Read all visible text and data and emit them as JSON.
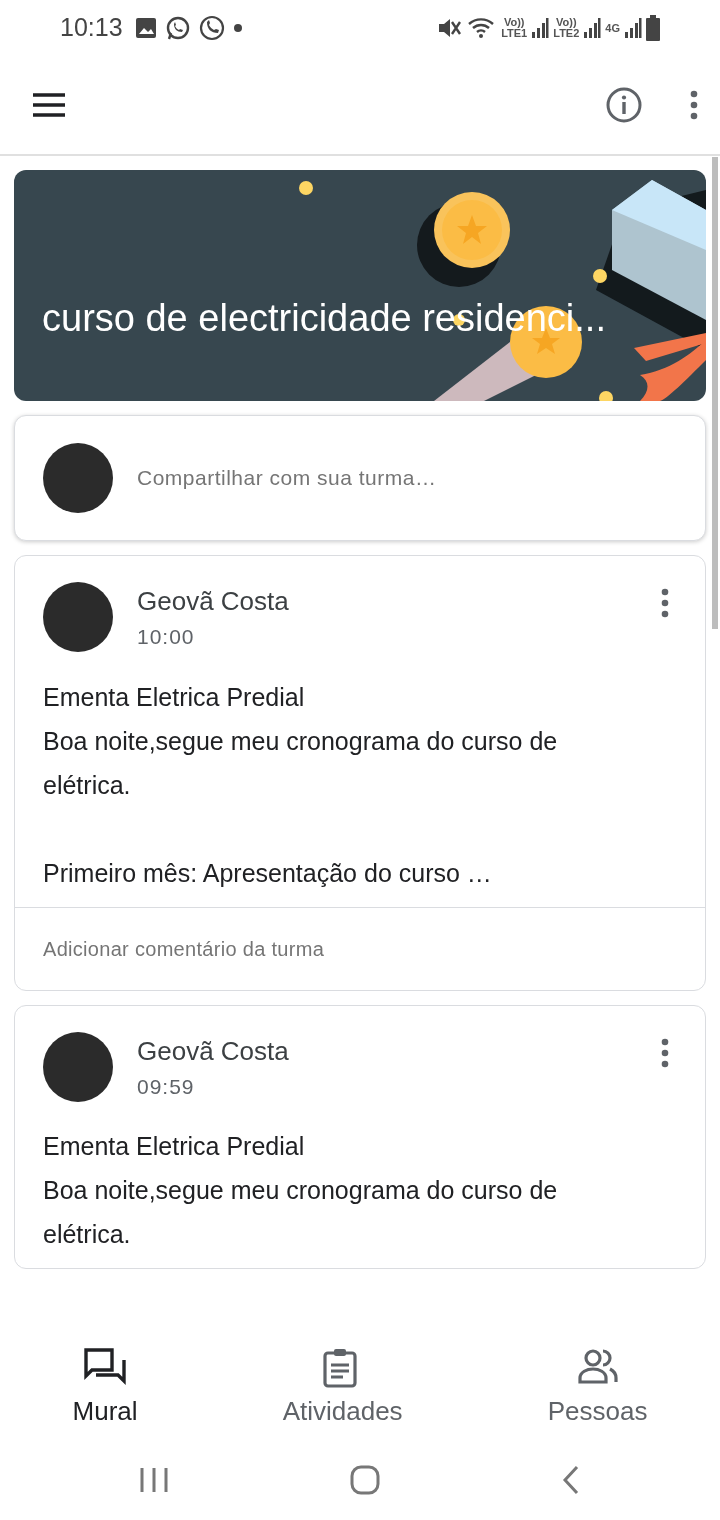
{
  "status_bar": {
    "time": "10:13",
    "network_labels": [
      {
        "top": "Vo))",
        "bottom": "LTE1"
      },
      {
        "top": "Vo))",
        "bottom": "LTE2"
      },
      {
        "top": "4G"
      }
    ]
  },
  "class_banner": {
    "title": "curso de electricidade residenci..."
  },
  "share_box": {
    "placeholder": "Compartilhar com sua turma…"
  },
  "posts": [
    {
      "author": "Geovã Costa",
      "time": "10:00",
      "body": "Ementa Eletrica Predial\nBoa noite,segue meu cronograma do curso de elétrica.\n\nPrimeiro mês: Apresentação do curso …",
      "comment_placeholder": "Adicionar comentário da turma"
    },
    {
      "author": "Geovã Costa",
      "time": "09:59",
      "body": "Ementa Eletrica Predial\nBoa noite,segue meu cronograma do curso de elétrica."
    }
  ],
  "bottom_nav": [
    {
      "label": "Mural",
      "kind": "stream",
      "selected": true
    },
    {
      "label": "Atividades",
      "kind": "classwork",
      "selected": false
    },
    {
      "label": "Pessoas",
      "kind": "people",
      "selected": false
    }
  ]
}
